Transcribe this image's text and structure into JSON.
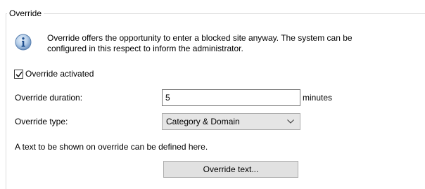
{
  "group": {
    "title": "Override"
  },
  "info": {
    "icon": "info-icon",
    "text_line1": "Override offers the opportunity to enter a blocked site anyway. The system can be",
    "text_line2": "configured in this respect to inform the administrator."
  },
  "override_activated": {
    "label": "Override activated",
    "checked": true
  },
  "duration": {
    "label": "Override duration:",
    "value": "5",
    "unit": "minutes"
  },
  "type": {
    "label": "Override type:",
    "selected": "Category & Domain",
    "icon": "chevron-down-icon"
  },
  "override_text": {
    "hint": "A text to be shown on override can be defined here.",
    "button_label": "Override text..."
  },
  "colors": {
    "icon_blue": "#2f6fb8",
    "border": "#dcdcdc",
    "select_bg": "#e5e5e5",
    "button_bg": "#e1e1e1"
  }
}
